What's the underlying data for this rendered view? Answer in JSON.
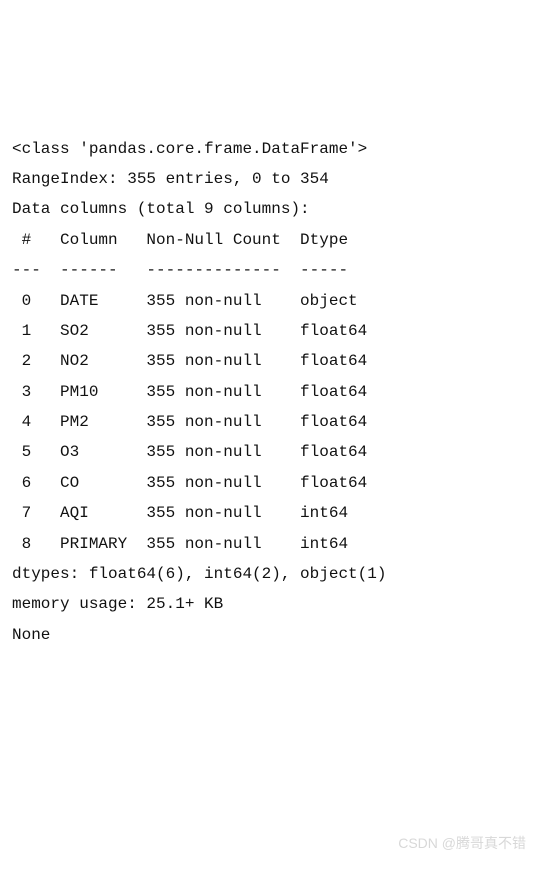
{
  "header": {
    "class_line": "<class 'pandas.core.frame.DataFrame'>",
    "range_index": "RangeIndex: 355 entries, 0 to 354",
    "data_columns": "Data columns (total 9 columns):"
  },
  "table": {
    "header_row": " #   Column   Non-Null Count  Dtype  ",
    "divider_row": "---  ------   --------------  -----  ",
    "rows": [
      " 0   DATE     355 non-null    object ",
      " 1   SO2      355 non-null    float64",
      " 2   NO2      355 non-null    float64",
      " 3   PM10     355 non-null    float64",
      " 4   PM2      355 non-null    float64",
      " 5   O3       355 non-null    float64",
      " 6   CO       355 non-null    float64",
      " 7   AQI      355 non-null    int64  ",
      " 8   PRIMARY  355 non-null    int64  "
    ]
  },
  "footer": {
    "dtypes": "dtypes: float64(6), int64(2), object(1)",
    "memory": "memory usage: 25.1+ KB",
    "none": "None"
  },
  "watermark": "CSDN @腾哥真不错",
  "chart_data": {
    "type": "table",
    "title": "pandas DataFrame.info() output",
    "range_index": {
      "entries": 355,
      "start": 0,
      "stop": 354
    },
    "total_columns": 9,
    "columns": [
      {
        "index": 0,
        "name": "DATE",
        "non_null": 355,
        "dtype": "object"
      },
      {
        "index": 1,
        "name": "SO2",
        "non_null": 355,
        "dtype": "float64"
      },
      {
        "index": 2,
        "name": "NO2",
        "non_null": 355,
        "dtype": "float64"
      },
      {
        "index": 3,
        "name": "PM10",
        "non_null": 355,
        "dtype": "float64"
      },
      {
        "index": 4,
        "name": "PM2",
        "non_null": 355,
        "dtype": "float64"
      },
      {
        "index": 5,
        "name": "O3",
        "non_null": 355,
        "dtype": "float64"
      },
      {
        "index": 6,
        "name": "CO",
        "non_null": 355,
        "dtype": "float64"
      },
      {
        "index": 7,
        "name": "AQI",
        "non_null": 355,
        "dtype": "int64"
      },
      {
        "index": 8,
        "name": "PRIMARY",
        "non_null": 355,
        "dtype": "int64"
      }
    ],
    "dtypes_summary": {
      "float64": 6,
      "int64": 2,
      "object": 1
    },
    "memory_usage": "25.1+ KB"
  }
}
